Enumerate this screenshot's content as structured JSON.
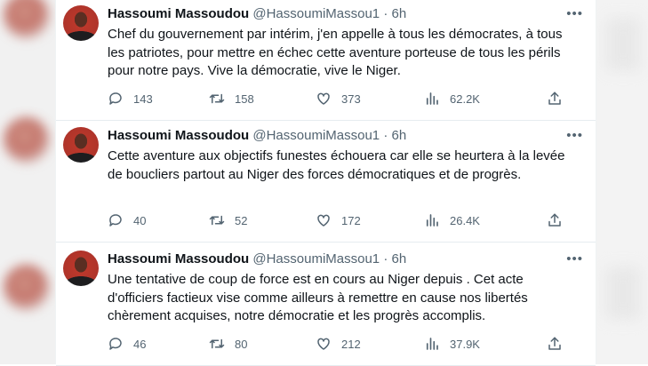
{
  "tweets": [
    {
      "name": "Hassoumi Massoudou",
      "handle": "@HassoumiMassou1",
      "time": "6h",
      "text": "Chef du gouvernement par intérim, j'en appelle à tous les démocrates, à tous les patriotes, pour mettre en échec cette aventure porteuse de tous les périls pour notre pays. Vive la démocratie, vive le Niger.",
      "replies": "143",
      "retweets": "158",
      "likes": "373",
      "views": "62.2K"
    },
    {
      "name": "Hassoumi Massoudou",
      "handle": "@HassoumiMassou1",
      "time": "6h",
      "text": "Cette aventure aux objectifs funestes échouera car elle se heurtera à la levée de boucliers partout au Niger des forces démocratiques et de progrès.",
      "replies": "40",
      "retweets": "52",
      "likes": "172",
      "views": "26.4K"
    },
    {
      "name": "Hassoumi Massoudou",
      "handle": "@HassoumiMassou1",
      "time": "6h",
      "text": "Une tentative de coup de force est en cours au Niger depuis . Cet acte d'officiers factieux vise comme ailleurs à remettre en cause nos libertés chèrement acquises, notre démocratie et les progrès accomplis.",
      "replies": "46",
      "retweets": "80",
      "likes": "212",
      "views": "37.9K"
    }
  ],
  "icons": {
    "reply": "speech-bubble-icon",
    "retweet": "retweet-arrows-icon",
    "like": "heart-icon",
    "views": "bar-chart-icon",
    "share": "share-upload-icon",
    "more": "more-dots-icon"
  },
  "colors": {
    "text": "#0f1419",
    "secondary": "#536471",
    "divider": "#e6ecf0"
  }
}
